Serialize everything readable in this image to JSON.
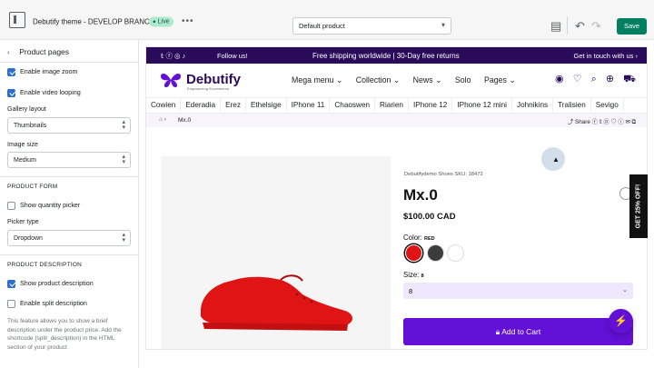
{
  "topbar": {
    "theme_title": "Debutify theme - DEVELOP BRANCH",
    "live_badge": "Live",
    "more_label": "•••",
    "template_select": "Default product",
    "save_label": "Save"
  },
  "sidebar": {
    "title": "Product pages",
    "enable_image_zoom": "Enable image zoom",
    "enable_video_looping": "Enable video looping",
    "gallery_layout_label": "Gallery layout",
    "gallery_layout_value": "Thumbnails",
    "image_size_label": "Image size",
    "image_size_value": "Medium",
    "product_form_section": "PRODUCT FORM",
    "show_quantity_picker": "Show quantity picker",
    "picker_type_label": "Picker type",
    "picker_type_value": "Dropdown",
    "product_description_section": "PRODUCT DESCRIPTION",
    "show_product_description": "Show product description",
    "enable_split_description": "Enable split description",
    "help_text": "This feature allows you to show a brief description under the product price. Add the shortcode {split_description} in the HTML section of your product"
  },
  "store": {
    "announcement": {
      "follow": "Follow us!",
      "center": "Free shipping worldwide | 30-Day free returns",
      "right": "Get in touch with us"
    },
    "logo_text": "Debutify",
    "logo_tagline": "Empowering Ecommerce",
    "nav": [
      "Mega menu ⌄",
      "Collection ⌄",
      "News ⌄",
      "Solo",
      "Pages ⌄"
    ],
    "collections": [
      "Cowien",
      "Ederadia",
      "Erez",
      "Ethelsige",
      "IPhone 11",
      "Chaoswen",
      "Riarien",
      "IPhone 12",
      "IPhone 12 mini",
      "Johnikins",
      "Tralisien",
      "Sevigo"
    ],
    "breadcrumb_current": "Mx.0",
    "share_label": "Share",
    "product": {
      "meta": "Debutifydemo   Shoes   SKU: 18472",
      "title": "Mx.0",
      "price": "$100.00 CAD",
      "color_label": "Color:",
      "color_value": "RED",
      "size_label": "Size:",
      "size_value": "8",
      "size_select": "8",
      "add_to_cart": "Add to Cart"
    },
    "side_tab": "GET 25% OFF!",
    "colors": {
      "brand": "#2a0b5a",
      "cart": "#6210d6",
      "swatch_red": "#e01414",
      "swatch_dark": "#3c3c3c",
      "swatch_white": "#ffffff"
    }
  }
}
